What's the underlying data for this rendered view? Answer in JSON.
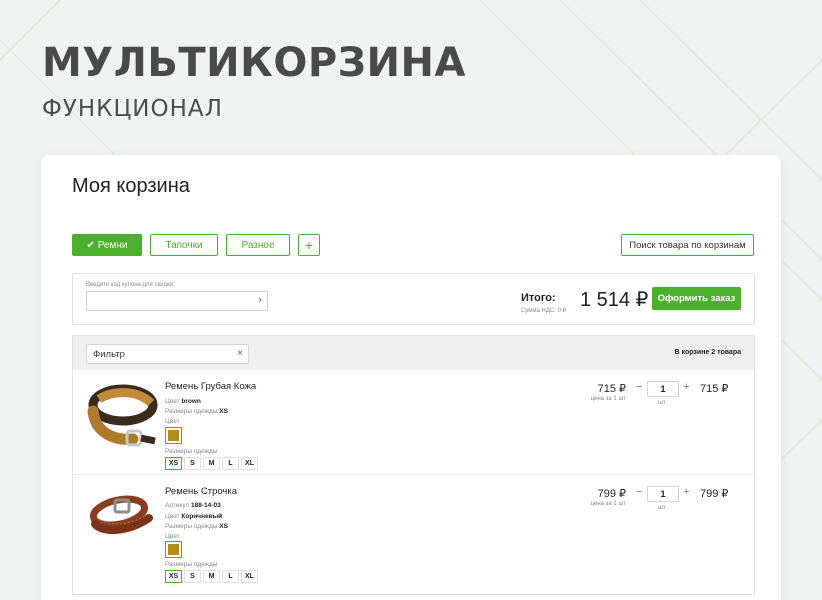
{
  "hero": {
    "title": "МУЛЬТИКОРЗИНА",
    "subtitle": "ФУНКЦИОНАЛ"
  },
  "card": {
    "title": "Моя корзина"
  },
  "tabs": [
    {
      "label": "✔ Ремни",
      "active": true
    },
    {
      "label": "Тапочки",
      "active": false
    },
    {
      "label": "Разное",
      "active": false
    }
  ],
  "add_tab_label": "+",
  "search_button_label": "Поиск товара по корзинам",
  "coupon": {
    "label": "Введите код купона для скидки:",
    "value": "",
    "arrow": "›"
  },
  "totals": {
    "label": "Итого:",
    "vat": "Сумма НДС: 0 ₽",
    "value": "1 514 ₽"
  },
  "order_button": "Оформить заказ",
  "filter": {
    "value": "Фильтр",
    "clear": "×"
  },
  "cart_count": "В корзине 2 товара",
  "items": [
    {
      "name": "Ремень Грубая Кожа",
      "color_label": "Цвет",
      "color_value": "brown",
      "sizes_label": "Размеры одежды",
      "size_value": "XS",
      "color_title": "Цвет",
      "sizes_title": "Размеры одежды",
      "sizes": [
        "XS",
        "S",
        "M",
        "L",
        "XL"
      ],
      "price": "715 ₽",
      "price_per": "цена за 1 шт",
      "qty": "1",
      "qty_unit": "шт",
      "sum": "715 ₽"
    },
    {
      "name": "Ремень Строчка",
      "article_label": "Артикул",
      "article_value": "188-14-03",
      "color_label": "Цвет",
      "color_value": "Коричневый",
      "sizes_label": "Размеры одежды",
      "size_value": "XS",
      "color_title": "Цвет",
      "sizes_title": "Размеры одежды",
      "sizes": [
        "XS",
        "S",
        "M",
        "L",
        "XL"
      ],
      "price": "799 ₽",
      "price_per": "цена за 1 шт",
      "qty": "1",
      "qty_unit": "шт",
      "sum": "799 ₽"
    }
  ],
  "qty_minus": "−",
  "qty_plus": "+",
  "colors": {
    "accent": "#4caf2d",
    "swatch": "#b38b1a"
  }
}
